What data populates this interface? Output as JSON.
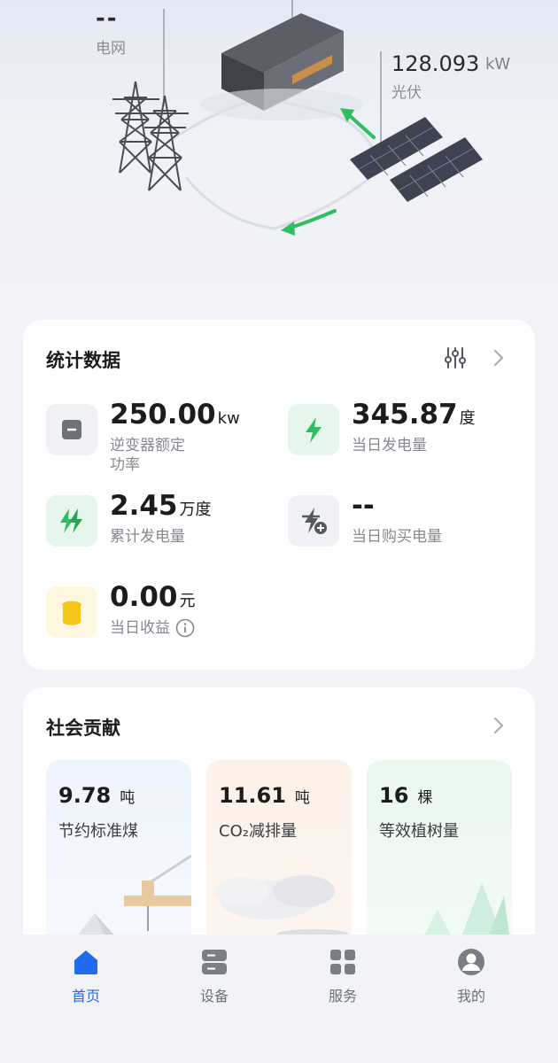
{
  "scene": {
    "grid": {
      "value": "--",
      "label": "电网"
    },
    "pv": {
      "value": "128.093",
      "unit": "kW",
      "label": "光伏"
    }
  },
  "stats": {
    "title": "统计数据",
    "items": [
      {
        "value": "250.00",
        "unit": "kw",
        "label_line1": "逆变器额定",
        "label_line2": "功率",
        "icon": "inverter-icon"
      },
      {
        "value": "345.87",
        "unit": "度",
        "label_line1": "当日发电量",
        "icon": "lightning-icon"
      },
      {
        "value": "2.45",
        "unit": "万度",
        "label_line1": "累计发电量",
        "icon": "double-lightning-icon"
      },
      {
        "value": "--",
        "unit": "",
        "label_line1": "当日购买电量",
        "icon": "lightning-plus-icon"
      },
      {
        "value": "0.00",
        "unit": "元",
        "label_line1": "当日收益",
        "icon": "coins-icon"
      }
    ]
  },
  "social": {
    "title": "社会贡献",
    "tiles": [
      {
        "value": "9.78",
        "unit": "吨",
        "label": "节约标准煤"
      },
      {
        "value": "11.61",
        "unit": "吨",
        "label": "CO₂减排量"
      },
      {
        "value": "16",
        "unit": "棵",
        "label": "等效植树量"
      }
    ]
  },
  "tabs": [
    {
      "label": "首页",
      "active": true
    },
    {
      "label": "设备",
      "active": false
    },
    {
      "label": "服务",
      "active": false
    },
    {
      "label": "我的",
      "active": false
    }
  ],
  "colors": {
    "accent": "#1f6bf0",
    "green": "#2fbf5f",
    "coin": "#f5c518"
  }
}
